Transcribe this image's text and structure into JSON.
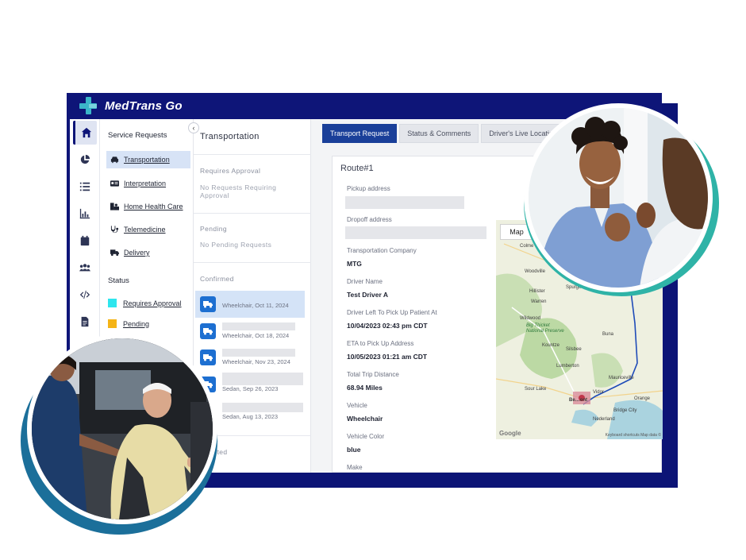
{
  "app": {
    "brand": "MedTrans Go"
  },
  "rail": {
    "icons": [
      "home-icon",
      "pie-chart-icon",
      "list-icon",
      "bar-chart-icon",
      "calendar-icon",
      "users-icon",
      "code-icon",
      "document-icon"
    ]
  },
  "service_panel": {
    "heading": "Service Requests",
    "items": [
      {
        "label": "Transportation",
        "icon": "car-icon",
        "active": true
      },
      {
        "label": "Interpretation",
        "icon": "id-card-icon"
      },
      {
        "label": "Home Health Care",
        "icon": "home-care-icon"
      },
      {
        "label": "Telemedicine",
        "icon": "stethoscope-icon"
      },
      {
        "label": "Delivery",
        "icon": "truck-icon"
      }
    ],
    "status_heading": "Status",
    "statuses": [
      {
        "label": "Requires Approval",
        "color": "#2ee6ee"
      },
      {
        "label": "Pending",
        "color": "#f5b416"
      }
    ]
  },
  "transport_list": {
    "title": "Transportation",
    "sections": {
      "requires_approval": "Requires Approval",
      "no_requests": "No Requests Requiring Approval",
      "pending": "Pending",
      "no_pending": "No Pending Requests",
      "confirmed": "Confirmed",
      "completed": "…pleted"
    },
    "cards": [
      {
        "label": "Wheelchair, Oct 11, 2024"
      },
      {
        "label": "Wheelchair, Oct 18, 2024"
      },
      {
        "label": "Wheelchair, Nov 23, 2024"
      },
      {
        "label": "Sedan, Sep 26, 2023"
      },
      {
        "label": "Sedan, Aug 13, 2023"
      }
    ]
  },
  "tabs": [
    "Transport Request",
    "Status & Comments",
    "Driver's Live Locatio"
  ],
  "detail": {
    "route": "Route#1",
    "fields": [
      {
        "label": "Pickup address",
        "value": ""
      },
      {
        "label": "Dropoff address",
        "value": ""
      },
      {
        "label": "Transportation Company",
        "value": "MTG"
      },
      {
        "label": "Driver Name",
        "value": "Test Driver A"
      },
      {
        "label": "Driver Left To Pick Up Patient At",
        "value": "10/04/2023 02:43 pm CDT"
      },
      {
        "label": "ETA to Pick Up Address",
        "value": "10/05/2023 01:21 am CDT"
      },
      {
        "label": "Total Trip Distance",
        "value": "68.94 Miles"
      },
      {
        "label": "Vehicle",
        "value": "Wheelchair"
      },
      {
        "label": "Vehicle Color",
        "value": "blue"
      },
      {
        "label": "Make",
        "value": ""
      }
    ]
  },
  "map": {
    "button": "Map",
    "labels": [
      "Colme",
      "Woodville",
      "Spurger",
      "Hillister",
      "Warren",
      "Wildwood",
      "Big Thicket National Preserve",
      "Kountze",
      "Silsbee",
      "Buna",
      "Lumberton",
      "Mauriceville",
      "Sour Lake",
      "Vidor",
      "Orange",
      "Bridge City",
      "Nederland",
      "Be…ont"
    ],
    "google": "Google",
    "footer": "Keyboard shortcuts   Map data ©"
  }
}
